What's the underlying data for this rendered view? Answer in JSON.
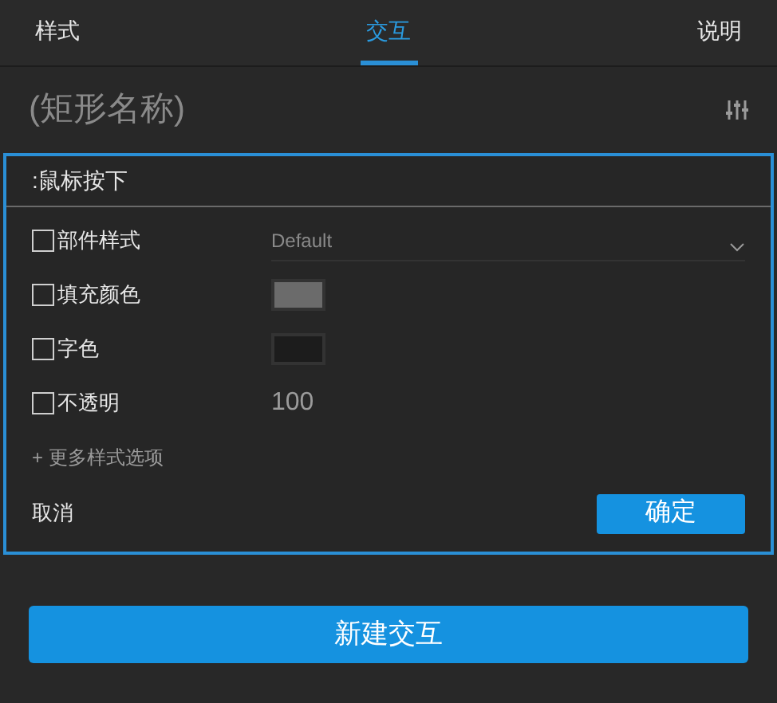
{
  "tabs": [
    {
      "label": "样式",
      "selected": false
    },
    {
      "label": "交互",
      "selected": true
    },
    {
      "label": "说明",
      "selected": false
    }
  ],
  "element_name": {
    "placeholder": "(矩形名称)"
  },
  "event_panel": {
    "title": ":鼠标按下",
    "rows": [
      {
        "kind": "dropdown",
        "label": "部件样式",
        "checked": false,
        "value": "Default"
      },
      {
        "kind": "swatch",
        "label": "填充颜色",
        "checked": false,
        "color": "#6b6b6b"
      },
      {
        "kind": "swatch",
        "label": "字色",
        "checked": false,
        "color": "#1c1c1c"
      },
      {
        "kind": "number",
        "label": "不透明",
        "checked": false,
        "value": "100"
      }
    ],
    "more_link": "+ 更多样式选项",
    "cancel": "取消",
    "confirm": "确定"
  },
  "new_button": "新建交互"
}
